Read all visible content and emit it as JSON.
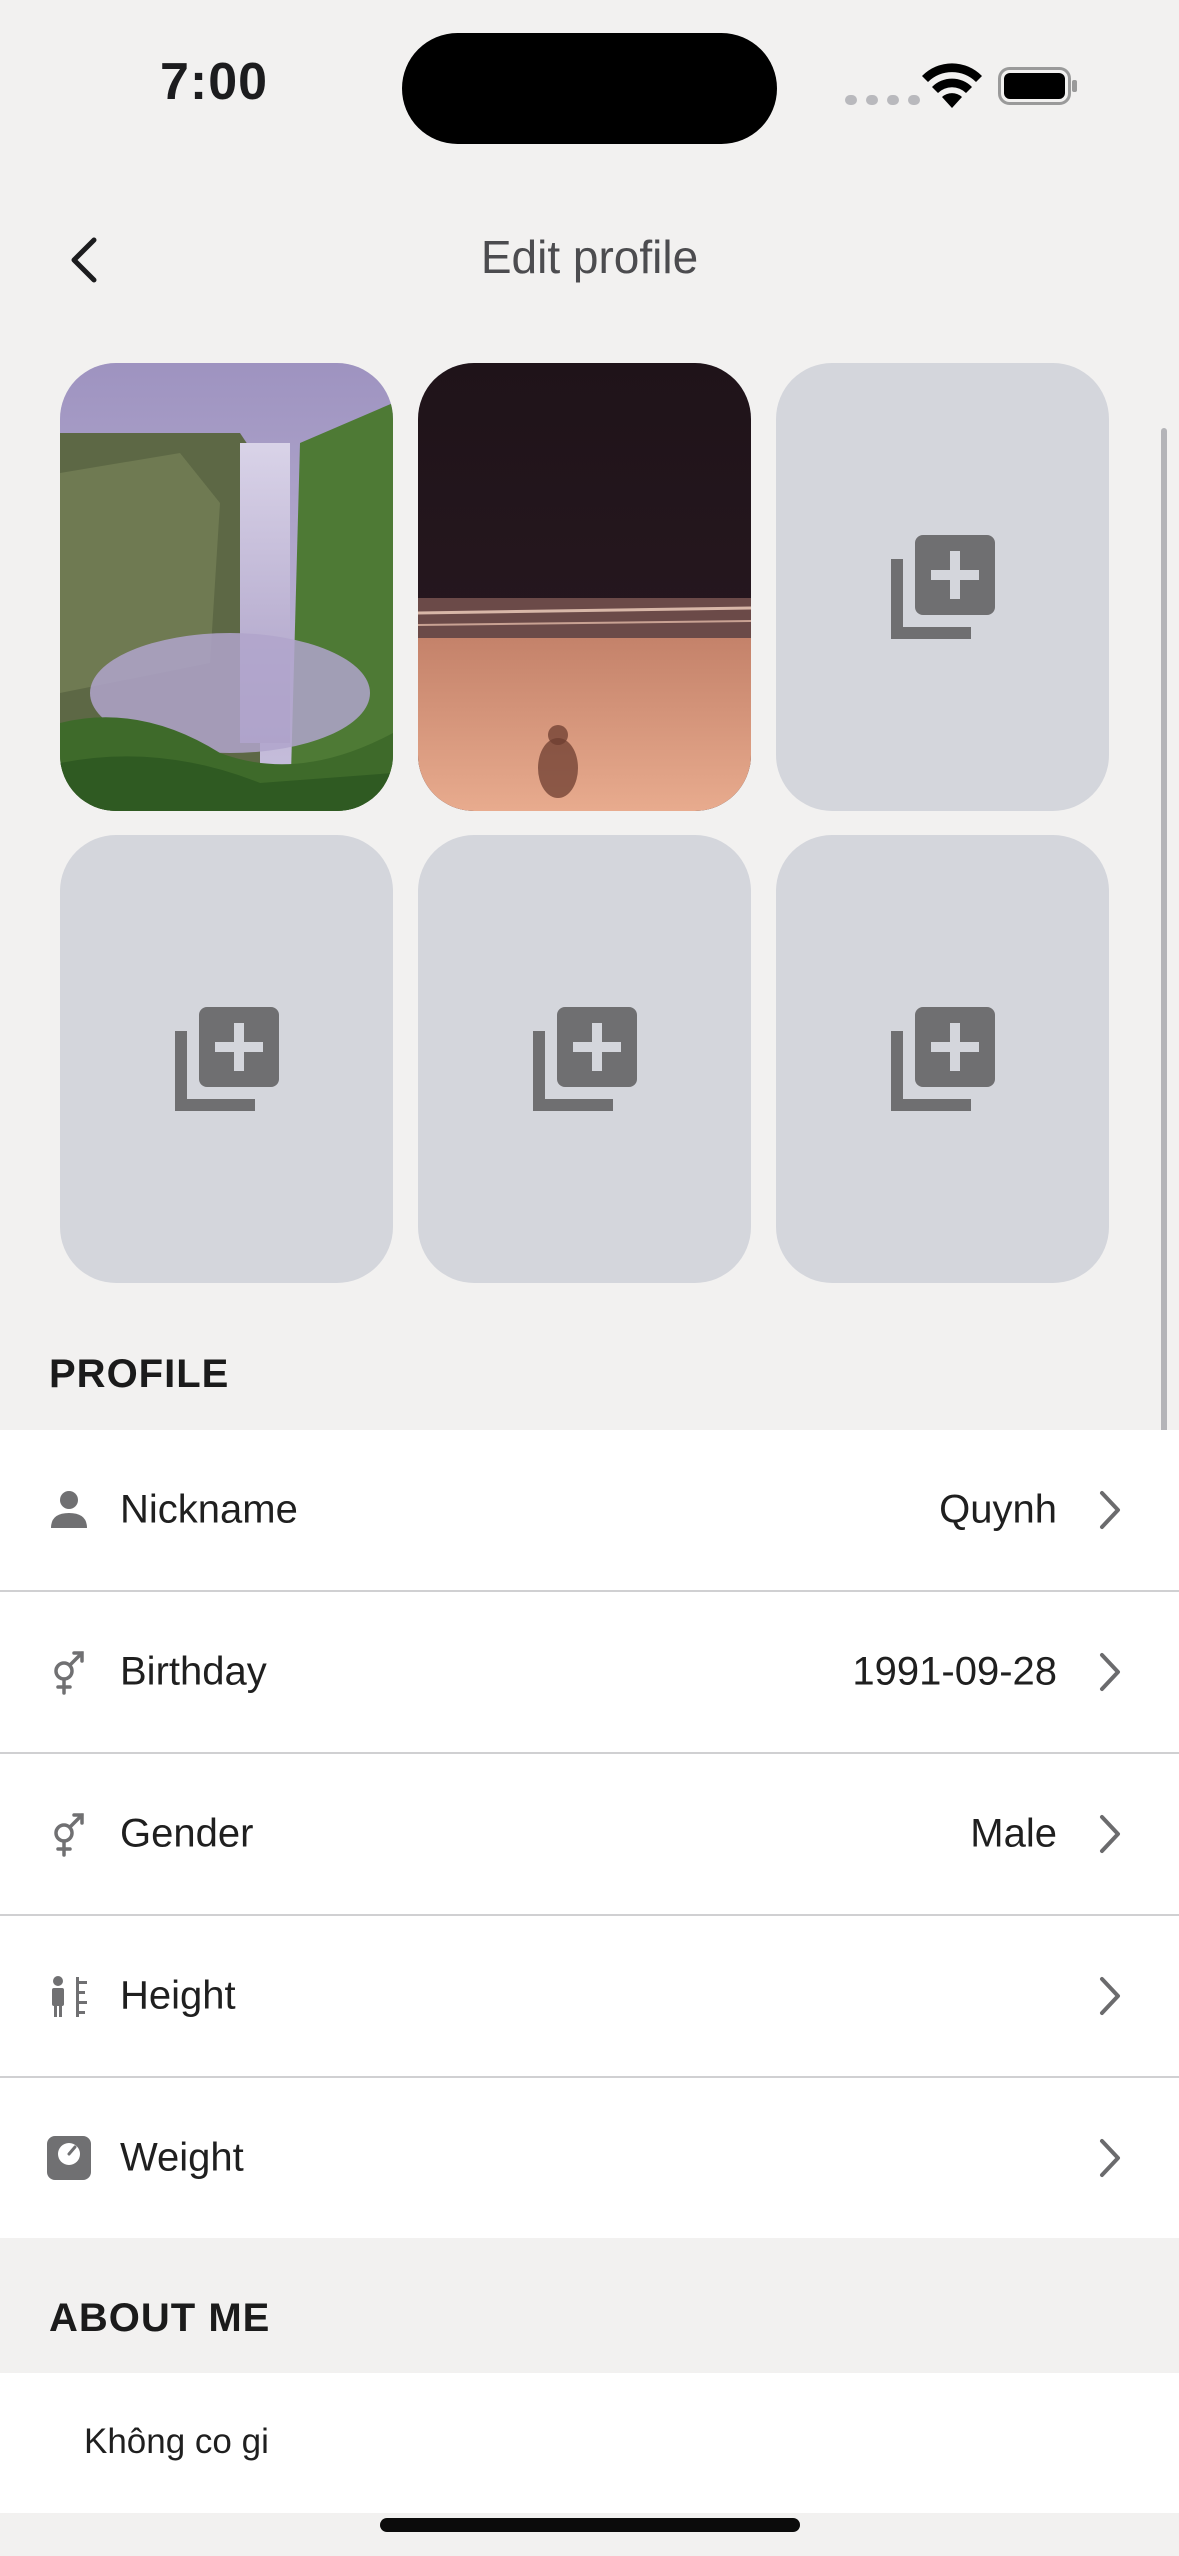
{
  "status_bar": {
    "time": "7:00"
  },
  "header": {
    "title": "Edit profile"
  },
  "photos": {
    "slots": [
      {
        "type": "photo",
        "subject": "waterfall"
      },
      {
        "type": "photo",
        "subject": "beach-shadow"
      },
      {
        "type": "empty"
      },
      {
        "type": "empty"
      },
      {
        "type": "empty"
      },
      {
        "type": "empty"
      }
    ]
  },
  "profile": {
    "heading": "PROFILE",
    "rows": [
      {
        "label": "Nickname",
        "value": "Quynh",
        "icon": "person-icon"
      },
      {
        "label": "Birthday",
        "value": "1991-09-28",
        "icon": "gender-icon"
      },
      {
        "label": "Gender",
        "value": "Male",
        "icon": "gender-icon"
      },
      {
        "label": "Height",
        "value": "",
        "icon": "height-icon"
      },
      {
        "label": "Weight",
        "value": "",
        "icon": "scale-icon"
      }
    ]
  },
  "about": {
    "heading": "ABOUT ME",
    "text": "Không co gi"
  },
  "colors": {
    "background": "#f2f1f0",
    "tile_empty": "#d4d6dc",
    "icon_gray": "#707072"
  }
}
